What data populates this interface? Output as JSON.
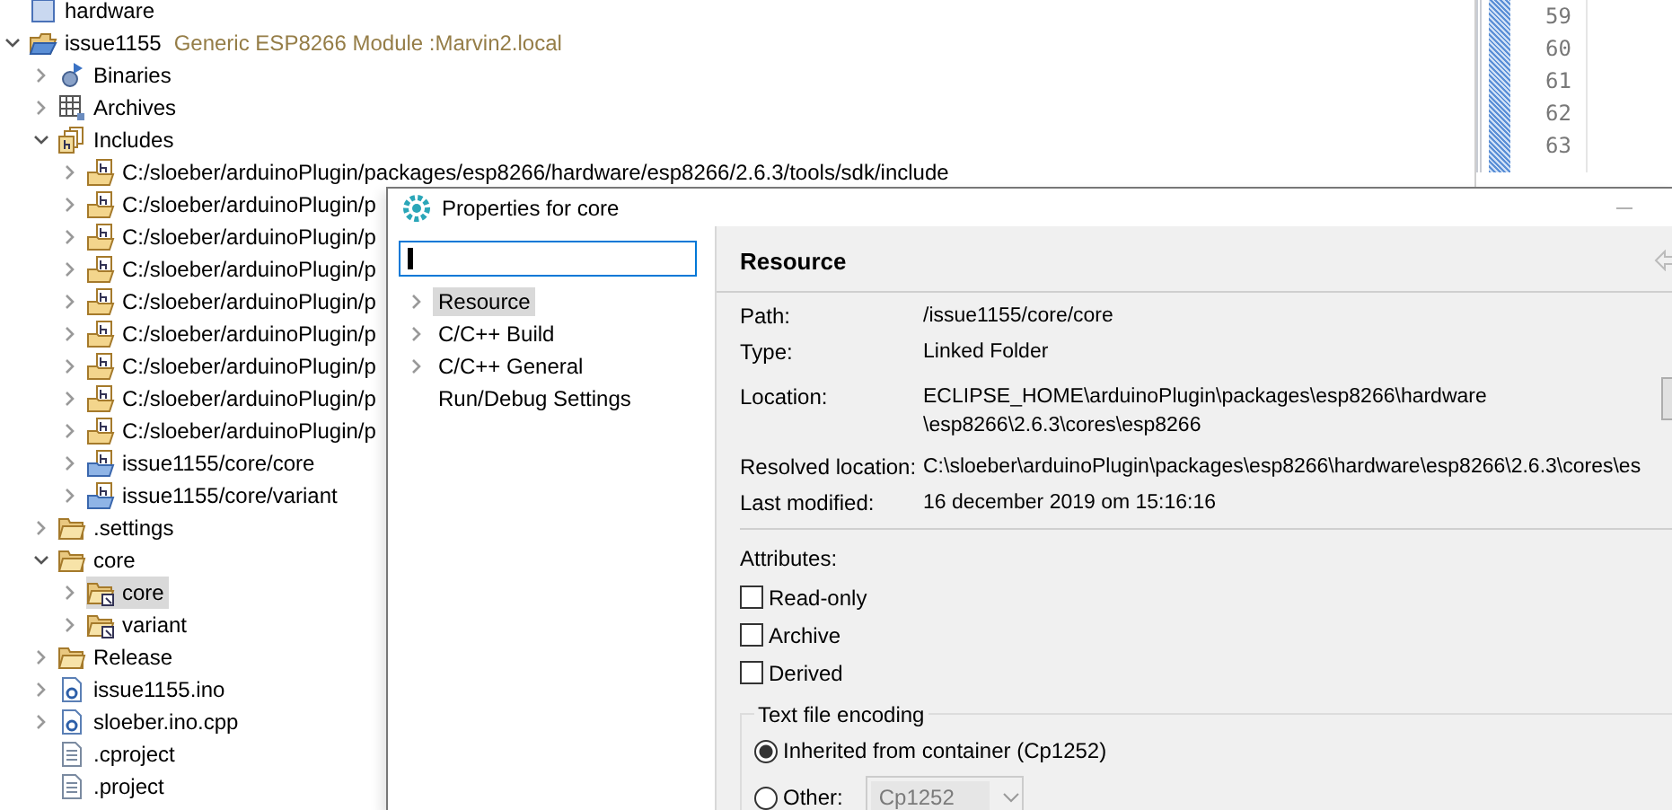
{
  "project_tree": {
    "items": [
      {
        "label": "hardware",
        "kind": "package",
        "selected": false
      },
      {
        "label": "issue1155",
        "description": "Generic ESP8266 Module :Marvin2.local",
        "kind": "project",
        "expanded": true,
        "selected": false,
        "children": [
          {
            "label": "Binaries",
            "kind": "binaries",
            "expanded": false,
            "selected": false
          },
          {
            "label": "Archives",
            "kind": "archives",
            "expanded": false,
            "selected": false
          },
          {
            "label": "Includes",
            "kind": "includes",
            "expanded": true,
            "selected": false,
            "children": [
              {
                "label": "C:/sloeber/arduinoPlugin/packages/esp8266/hardware/esp8266/2.6.3/tools/sdk/include",
                "kind": "include-folder",
                "expanded": false,
                "selected": false
              },
              {
                "label": "C:/sloeber/arduinoPlugin/p",
                "kind": "include-folder",
                "expanded": false,
                "selected": false
              },
              {
                "label": "C:/sloeber/arduinoPlugin/p",
                "kind": "include-folder",
                "expanded": false,
                "selected": false
              },
              {
                "label": "C:/sloeber/arduinoPlugin/p",
                "kind": "include-folder",
                "expanded": false,
                "selected": false
              },
              {
                "label": "C:/sloeber/arduinoPlugin/p",
                "kind": "include-folder",
                "expanded": false,
                "selected": false
              },
              {
                "label": "C:/sloeber/arduinoPlugin/p",
                "kind": "include-folder",
                "expanded": false,
                "selected": false
              },
              {
                "label": "C:/sloeber/arduinoPlugin/p",
                "kind": "include-folder",
                "expanded": false,
                "selected": false
              },
              {
                "label": "C:/sloeber/arduinoPlugin/p",
                "kind": "include-folder",
                "expanded": false,
                "selected": false
              },
              {
                "label": "C:/sloeber/arduinoPlugin/p",
                "kind": "include-folder",
                "expanded": false,
                "selected": false
              },
              {
                "label": "issue1155/core/core",
                "kind": "workspace-include",
                "expanded": false,
                "selected": false
              },
              {
                "label": "issue1155/core/variant",
                "kind": "workspace-include",
                "expanded": false,
                "selected": false
              }
            ]
          },
          {
            "label": ".settings",
            "kind": "folder",
            "expanded": false,
            "selected": false
          },
          {
            "label": "core",
            "kind": "folder",
            "expanded": true,
            "selected": false,
            "children": [
              {
                "label": "core",
                "kind": "linked-folder",
                "expanded": false,
                "selected": true
              },
              {
                "label": "variant",
                "kind": "linked-folder",
                "expanded": false,
                "selected": false
              }
            ]
          },
          {
            "label": "Release",
            "kind": "folder",
            "expanded": false,
            "selected": false
          },
          {
            "label": "issue1155.ino",
            "kind": "source-file",
            "expanded": false,
            "selected": false
          },
          {
            "label": "sloeber.ino.cpp",
            "kind": "source-file",
            "expanded": false,
            "selected": false
          },
          {
            "label": ".cproject",
            "kind": "text-file",
            "selected": false
          },
          {
            "label": ".project",
            "kind": "text-file",
            "selected": false
          }
        ]
      }
    ]
  },
  "editor": {
    "line_numbers": [
      "59",
      "60",
      "61",
      "62",
      "63"
    ]
  },
  "dialog": {
    "title": "Properties for core",
    "search": {
      "focused": true
    },
    "nav": [
      {
        "label": "Resource",
        "expanded": false,
        "selected": true
      },
      {
        "label": "C/C++ Build",
        "expanded": false,
        "selected": false
      },
      {
        "label": "C/C++ General",
        "expanded": false,
        "selected": false
      },
      {
        "label": "Run/Debug Settings",
        "selected": false
      }
    ],
    "page": {
      "title": "Resource",
      "properties": [
        {
          "label": "Path:",
          "lines": [
            "/issue1155/core/core"
          ]
        },
        {
          "label": "Type:",
          "lines": [
            "Linked Folder"
          ]
        },
        {
          "label": "Location:",
          "lines": [
            "ECLIPSE_HOME\\arduinoPlugin\\packages\\esp8266\\hardware",
            "\\esp8266\\2.6.3\\cores\\esp8266"
          ]
        },
        {
          "label": "Resolved location:",
          "lines": [
            "C:\\sloeber\\arduinoPlugin\\packages\\esp8266\\hardware\\esp8266\\2.6.3\\cores\\es"
          ]
        },
        {
          "label": "Last modified:",
          "lines": [
            "16 december 2019 om 15:16:16"
          ]
        }
      ],
      "attributes": {
        "label": "Attributes:",
        "options": [
          {
            "label": "Read-only",
            "checked": false
          },
          {
            "label": "Archive",
            "checked": false
          },
          {
            "label": "Derived",
            "checked": false
          }
        ]
      },
      "encoding": {
        "title": "Text file encoding",
        "options": [
          {
            "label": "Inherited from container (Cp1252)",
            "selected": true
          },
          {
            "label": "Other:",
            "selected": false
          }
        ],
        "combo": {
          "value": "Cp1252",
          "disabled": true
        }
      }
    }
  }
}
